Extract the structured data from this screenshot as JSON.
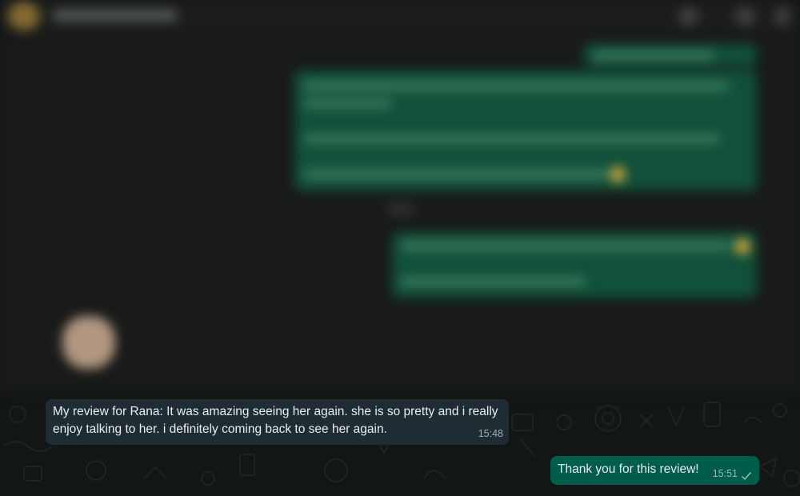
{
  "messages": [
    {
      "direction": "incoming",
      "text": "My review for Rana: It was amazing seeing her again. she is so pretty and i really enjoy talking to her. i definitely coming back to see her again.",
      "time": "15:48"
    },
    {
      "direction": "outgoing",
      "text": "Thank you for this review!",
      "time": "15:51",
      "status": "sent"
    }
  ],
  "colors": {
    "incoming_bubble": "#202c33",
    "outgoing_bubble": "#005c4b",
    "background": "#121614"
  },
  "icons": [
    "check-icon"
  ]
}
